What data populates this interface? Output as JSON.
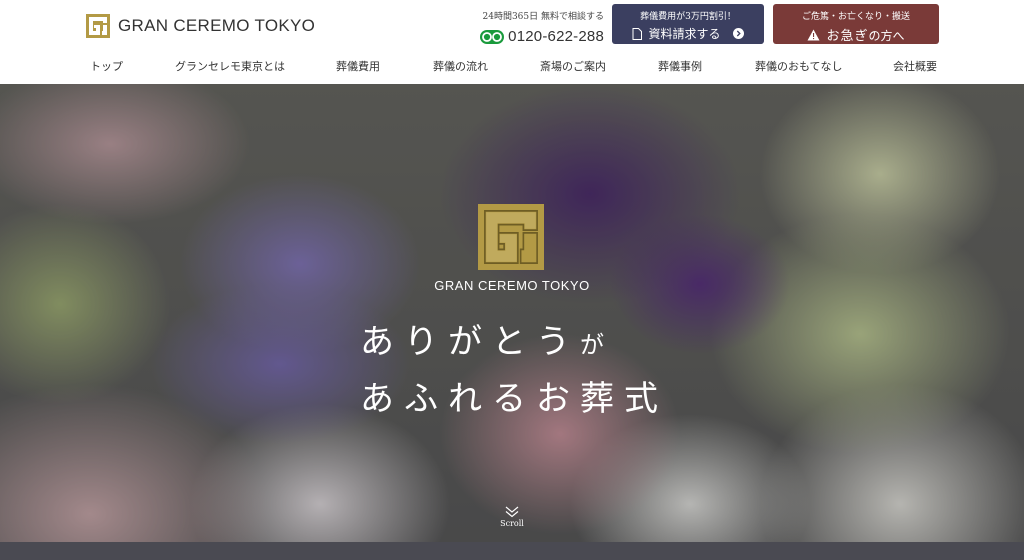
{
  "brand": {
    "name": "GRAN CEREMO TOKYO",
    "gold": "#b39a45"
  },
  "contact": {
    "note": "24時間365日 無料で相談する",
    "phone": "0120-622-288",
    "phone_icon": "freedial-icon"
  },
  "cta_docs": {
    "sub": "葬儀費用が3万円割引！",
    "label": "資料請求する",
    "color": "#3b3f60"
  },
  "cta_urgent": {
    "sub": "ご危篤・お亡くなり・搬送",
    "label_big": "お急ぎ",
    "label_rest": "の方へ",
    "color": "#7a3a38"
  },
  "nav": [
    "トップ",
    "グランセレモ東京とは",
    "葬儀費用",
    "葬儀の流れ",
    "斎場のご案内",
    "葬儀事例",
    "葬儀のおもてなし",
    "会社概要"
  ],
  "hero": {
    "brand": "GRAN CEREMO TOKYO",
    "line1_main": "ありがとう",
    "line1_small": "が",
    "line2": "あふれるお葬式",
    "scroll": "Scroll"
  }
}
